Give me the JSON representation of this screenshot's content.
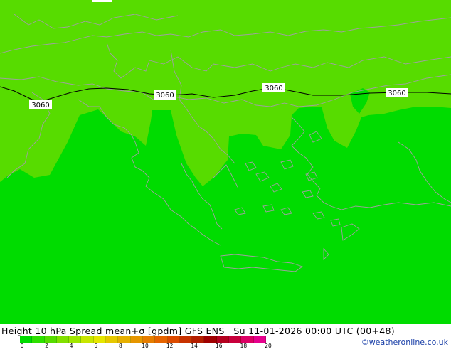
{
  "map": {
    "colors": {
      "background_high": "#57dc00",
      "background_low": "#00dc00",
      "coastline": "#a0a0a0",
      "contour": "#000000"
    },
    "contour_labels": [
      "3060",
      "3060",
      "3060",
      "3060"
    ]
  },
  "footer": {
    "title": "Height 10 hPa Spread mean+σ [gpdm] GFS ENS   Su 11-01-2026 00:00 UTC (00+48)",
    "credit": "©weatheronline.co.uk",
    "legend_colors": [
      "#00dc00",
      "#2ee000",
      "#57dc00",
      "#82e000",
      "#a0e600",
      "#c8e600",
      "#e6e600",
      "#e6c800",
      "#e6af00",
      "#e69600",
      "#e67d00",
      "#e66400",
      "#dc4b00",
      "#c83200",
      "#b41e00",
      "#a00000",
      "#b4001e",
      "#c8003c",
      "#dc0064",
      "#e6008c"
    ],
    "legend_ticks": [
      "0",
      "2",
      "4",
      "6",
      "8",
      "10",
      "12",
      "14",
      "16",
      "18",
      "20"
    ]
  }
}
